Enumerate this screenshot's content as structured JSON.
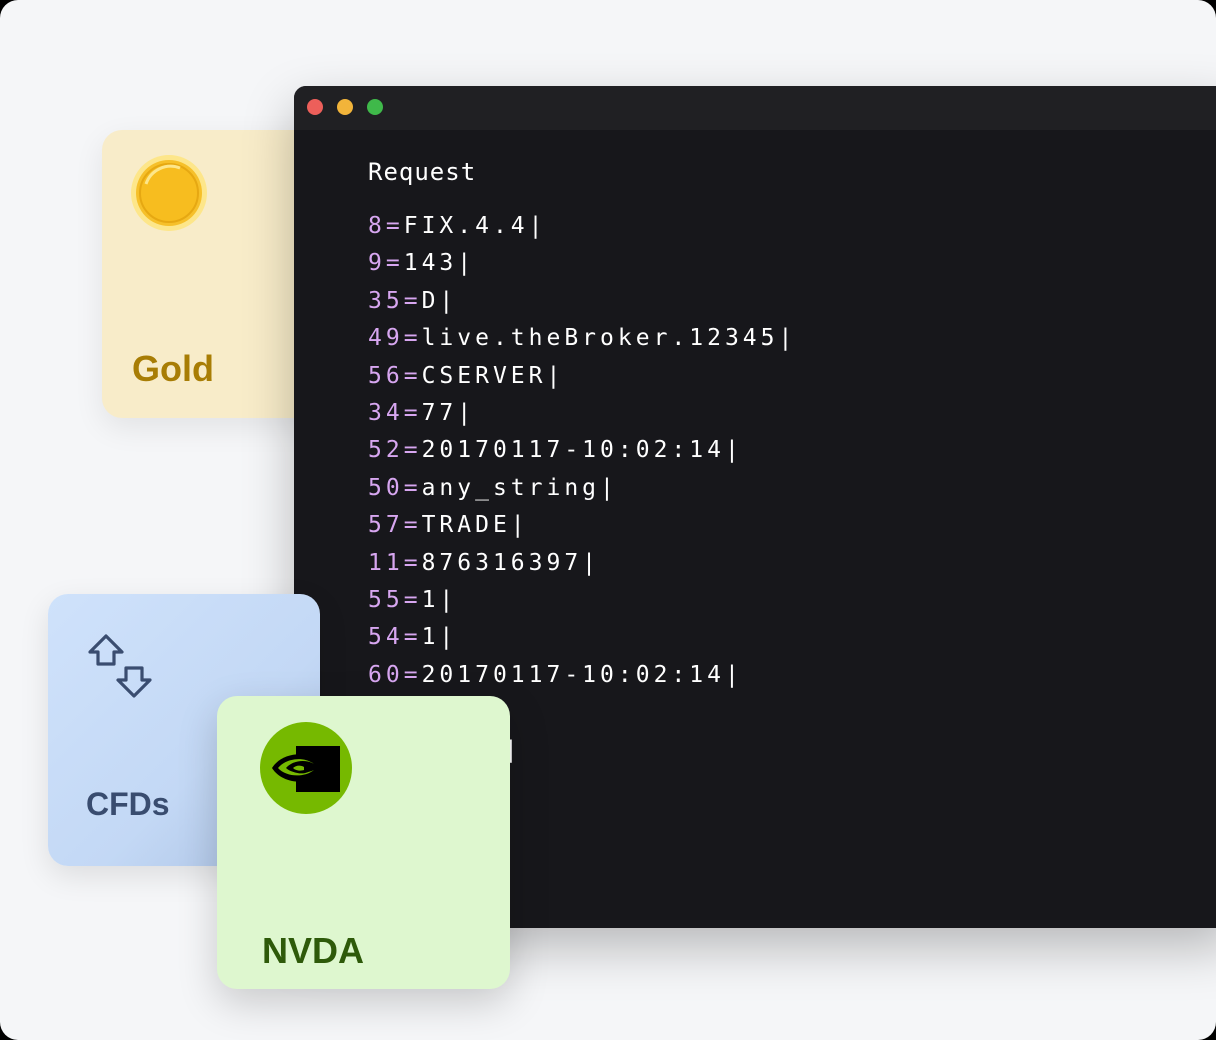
{
  "colors": {
    "background": "#f5f6f8",
    "terminal_bg": "#17171b",
    "titlebar_bg": "#202023",
    "close_dot": "#ed5f5a",
    "minimize_dot": "#f2b43a",
    "maximize_dot": "#3fb94a",
    "tag_color": "#d7a6f0",
    "gold_label": "#a87d05",
    "cfd_label": "#394c6f",
    "nvda_label": "#2e5a0a",
    "nvda_green": "#76b900"
  },
  "terminal": {
    "title": "Request",
    "lines": [
      {
        "tag": "8",
        "value": "FIX.4.4|"
      },
      {
        "tag": "9",
        "value": "143|"
      },
      {
        "tag": "35",
        "value": "D|"
      },
      {
        "tag": "49",
        "value": "live.theBroker.12345|"
      },
      {
        "tag": "56",
        "value": "CSERVER|"
      },
      {
        "tag": "34",
        "value": "77|"
      },
      {
        "tag": "52",
        "value": "20170117-10:02:14|"
      },
      {
        "tag": "50",
        "value": "any_string|"
      },
      {
        "tag": "57",
        "value": "TRADE|"
      },
      {
        "tag": "11",
        "value": "876316397|"
      },
      {
        "tag": "55",
        "value": "1|"
      },
      {
        "tag": "54",
        "value": "1|"
      },
      {
        "tag": "60",
        "value": "20170117-10:02:14|"
      }
    ],
    "partial_line": "0|"
  },
  "cards": {
    "gold": {
      "label": "Gold",
      "icon": "gold-coin-icon"
    },
    "cfds": {
      "label": "CFDs",
      "icon": "swap-arrows-icon"
    },
    "nvda": {
      "label": "NVDA",
      "icon": "nvidia-logo-icon"
    }
  }
}
